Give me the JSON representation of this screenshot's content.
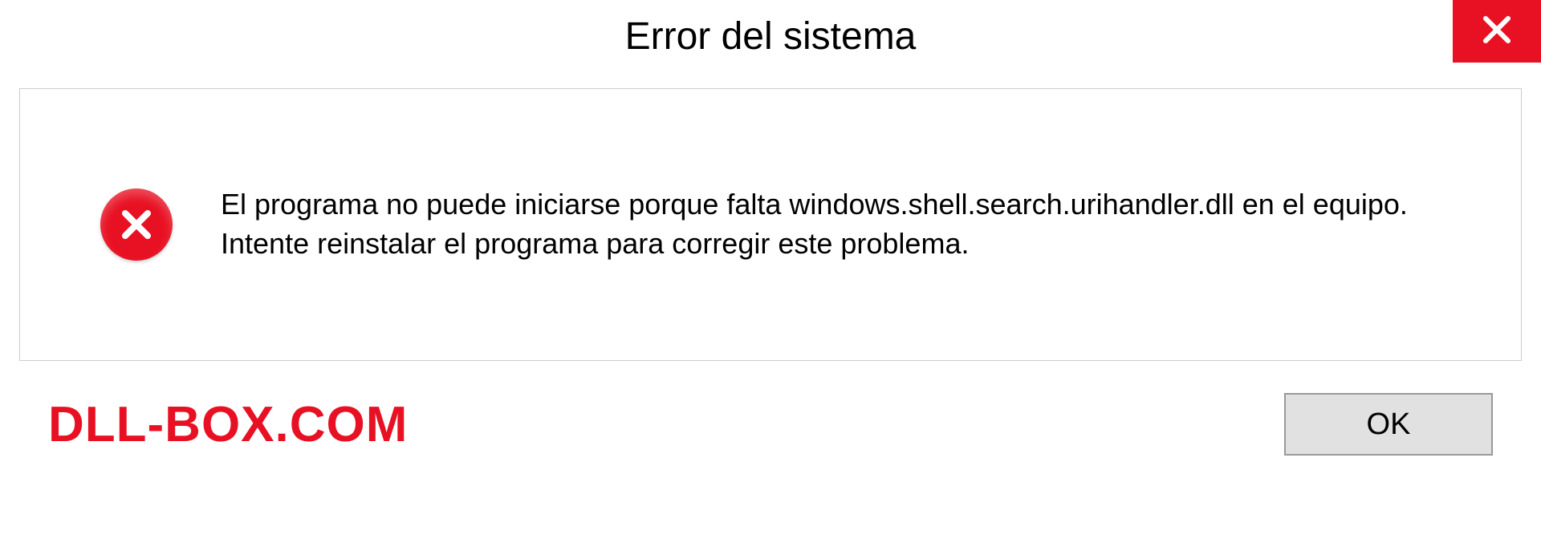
{
  "titlebar": {
    "title": "Error del sistema"
  },
  "dialog": {
    "message": "El programa no puede iniciarse porque falta windows.shell.search.urihandler.dll en el equipo. Intente reinstalar el programa para corregir este problema."
  },
  "footer": {
    "watermark": "DLL-BOX.COM",
    "ok_label": "OK"
  }
}
